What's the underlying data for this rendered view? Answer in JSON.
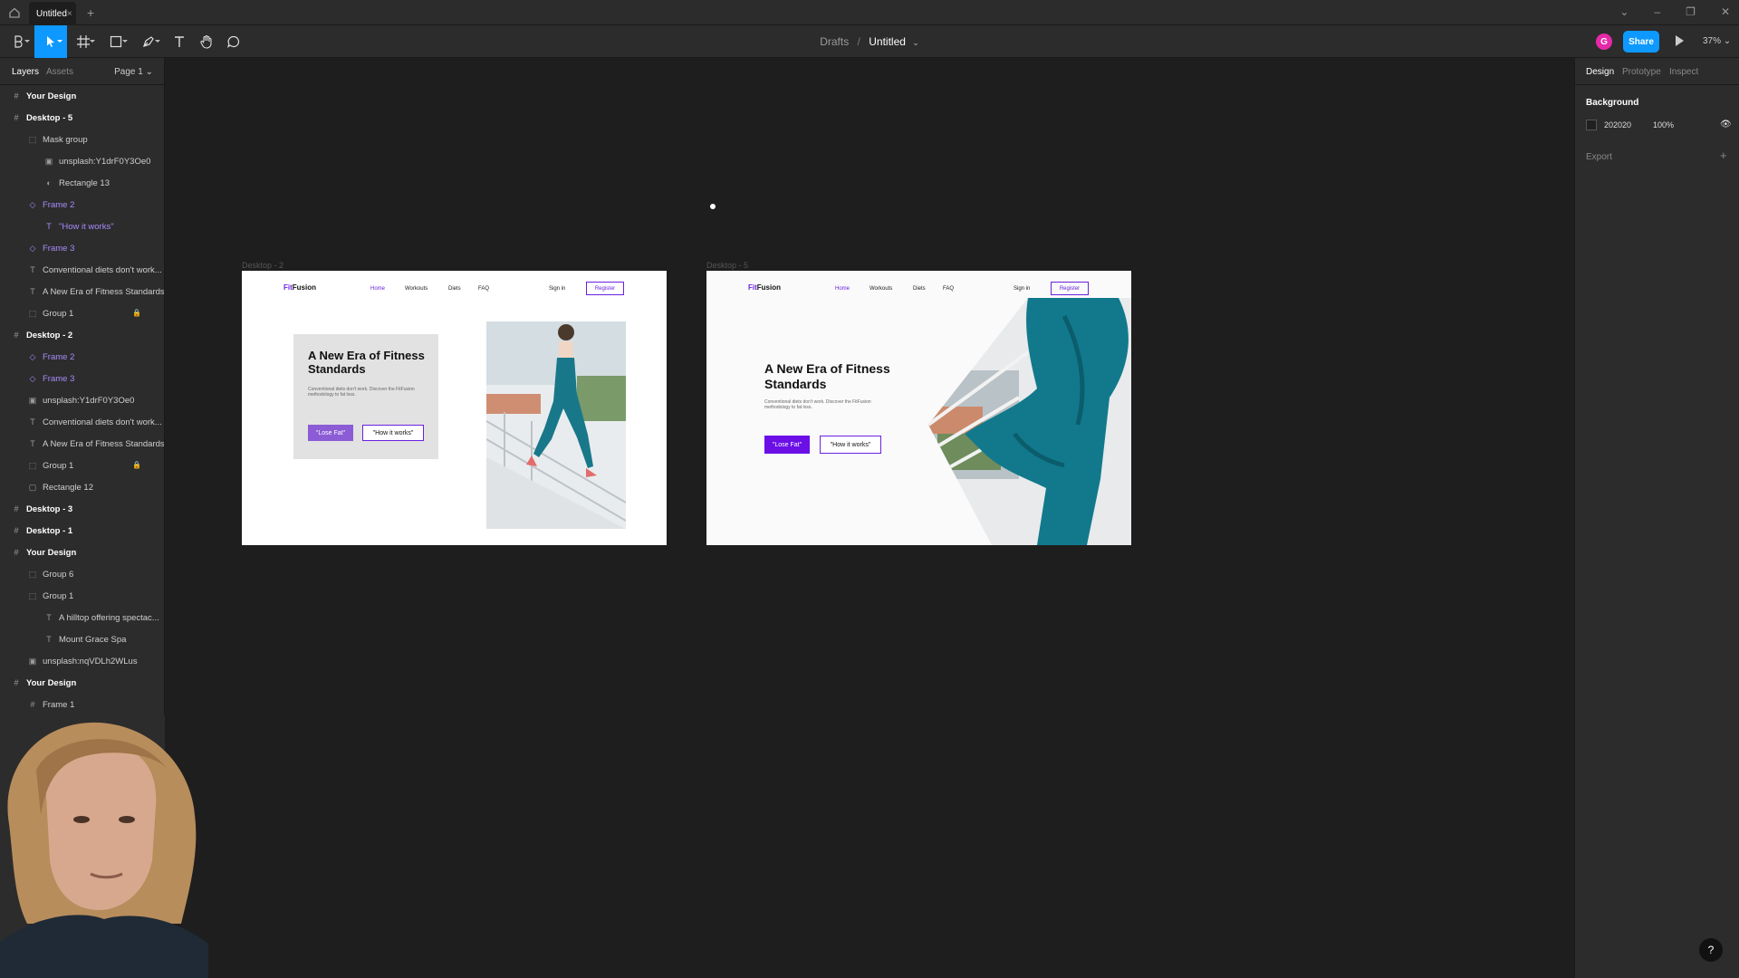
{
  "titlebar": {
    "tab_title": "Untitled",
    "tab_close": "×",
    "new_tab": "+"
  },
  "toolbar": {
    "breadcrumb_parent": "Drafts",
    "breadcrumb_sep": "/",
    "file_name": "Untitled",
    "avatar_initial": "G",
    "share_label": "Share",
    "zoom": "37%",
    "tools": [
      "main-menu-icon",
      "move-icon",
      "frame-icon",
      "shape-icon",
      "pen-icon",
      "text-icon",
      "hand-icon",
      "comment-icon"
    ]
  },
  "left_panel": {
    "tab_layers": "Layers",
    "tab_assets": "Assets",
    "page_label": "Page 1",
    "layers": [
      {
        "name": "Your Design",
        "type": "frame",
        "level": 0
      },
      {
        "name": "Desktop - 5",
        "type": "frame",
        "level": 0
      },
      {
        "name": "Mask group",
        "type": "group",
        "level": 1
      },
      {
        "name": "unsplash:Y1drF0Y3Oe0",
        "type": "image",
        "level": 2
      },
      {
        "name": "Rectangle 13",
        "type": "mask",
        "level": 2
      },
      {
        "name": "Frame 2",
        "type": "component",
        "level": 1
      },
      {
        "name": "\"How it works\"",
        "type": "text-component",
        "level": 2
      },
      {
        "name": "Frame 3",
        "type": "component",
        "level": 1
      },
      {
        "name": "Conventional diets don't work...",
        "type": "text",
        "level": 1
      },
      {
        "name": "A New Era of Fitness Standards",
        "type": "text",
        "level": 1
      },
      {
        "name": "Group 1",
        "type": "group",
        "level": 1,
        "locked": true
      },
      {
        "name": "Desktop - 2",
        "type": "frame",
        "level": 0
      },
      {
        "name": "Frame 2",
        "type": "component",
        "level": 1
      },
      {
        "name": "Frame 3",
        "type": "component",
        "level": 1
      },
      {
        "name": "unsplash:Y1drF0Y3Oe0",
        "type": "image",
        "level": 1
      },
      {
        "name": "Conventional diets don't work...",
        "type": "text",
        "level": 1
      },
      {
        "name": "A New Era of Fitness Standards",
        "type": "text",
        "level": 1
      },
      {
        "name": "Group 1",
        "type": "group",
        "level": 1,
        "locked": true
      },
      {
        "name": "Rectangle 12",
        "type": "rect",
        "level": 1
      },
      {
        "name": "Desktop - 3",
        "type": "frame",
        "level": 0
      },
      {
        "name": "Desktop - 1",
        "type": "frame",
        "level": 0
      },
      {
        "name": "Your Design",
        "type": "frame",
        "level": 0
      },
      {
        "name": "Group 6",
        "type": "group",
        "level": 1
      },
      {
        "name": "Group 1",
        "type": "group",
        "level": 1
      },
      {
        "name": "A hilltop offering spectac...",
        "type": "text",
        "level": 2
      },
      {
        "name": "Mount Grace Spa",
        "type": "text",
        "level": 2
      },
      {
        "name": "unsplash:nqVDLh2WLus",
        "type": "image",
        "level": 1
      },
      {
        "name": "Your Design",
        "type": "frame",
        "level": 0
      },
      {
        "name": "Frame 1",
        "type": "frame",
        "level": 1
      }
    ]
  },
  "canvas": {
    "frames": [
      {
        "label": "Desktop - 2",
        "logo_fit": "Fit",
        "logo_fusion": "Fusion",
        "nav": [
          "Home",
          "Workouts",
          "Diets",
          "FAQ"
        ],
        "sign_in": "Sign in",
        "register": "Register",
        "headline": "A New Era of Fitness Standards",
        "body": "Conventional diets don't work. Discover the FitFusion methodology to fat loss.",
        "cta_primary": "\"Lose Fat\"",
        "cta_secondary": "\"How it works\"",
        "primary_color": "#8b5cd6"
      },
      {
        "label": "Desktop - 5",
        "logo_fit": "Fit",
        "logo_fusion": "Fusion",
        "nav": [
          "Home",
          "Workouts",
          "Diets",
          "FAQ"
        ],
        "sign_in": "Sign in",
        "register": "Register",
        "headline": "A New Era of Fitness Standards",
        "body": "Conventional diets don't work. Discover the FitFusion methodology to fat loss.",
        "cta_primary": "\"Lose Fat\"",
        "cta_secondary": "\"How it works\"",
        "primary_color": "#6b0fe6"
      }
    ]
  },
  "right_panel": {
    "tab_design": "Design",
    "tab_prototype": "Prototype",
    "tab_inspect": "Inspect",
    "background_label": "Background",
    "bg_hex": "202020",
    "bg_opacity": "100%",
    "export_label": "Export",
    "export_plus": "+"
  },
  "help": "?",
  "colors": {
    "accent": "#0d99ff",
    "brand_purple": "#6b21e0",
    "panel": "#2c2c2c",
    "canvas": "#1e1e1e"
  }
}
